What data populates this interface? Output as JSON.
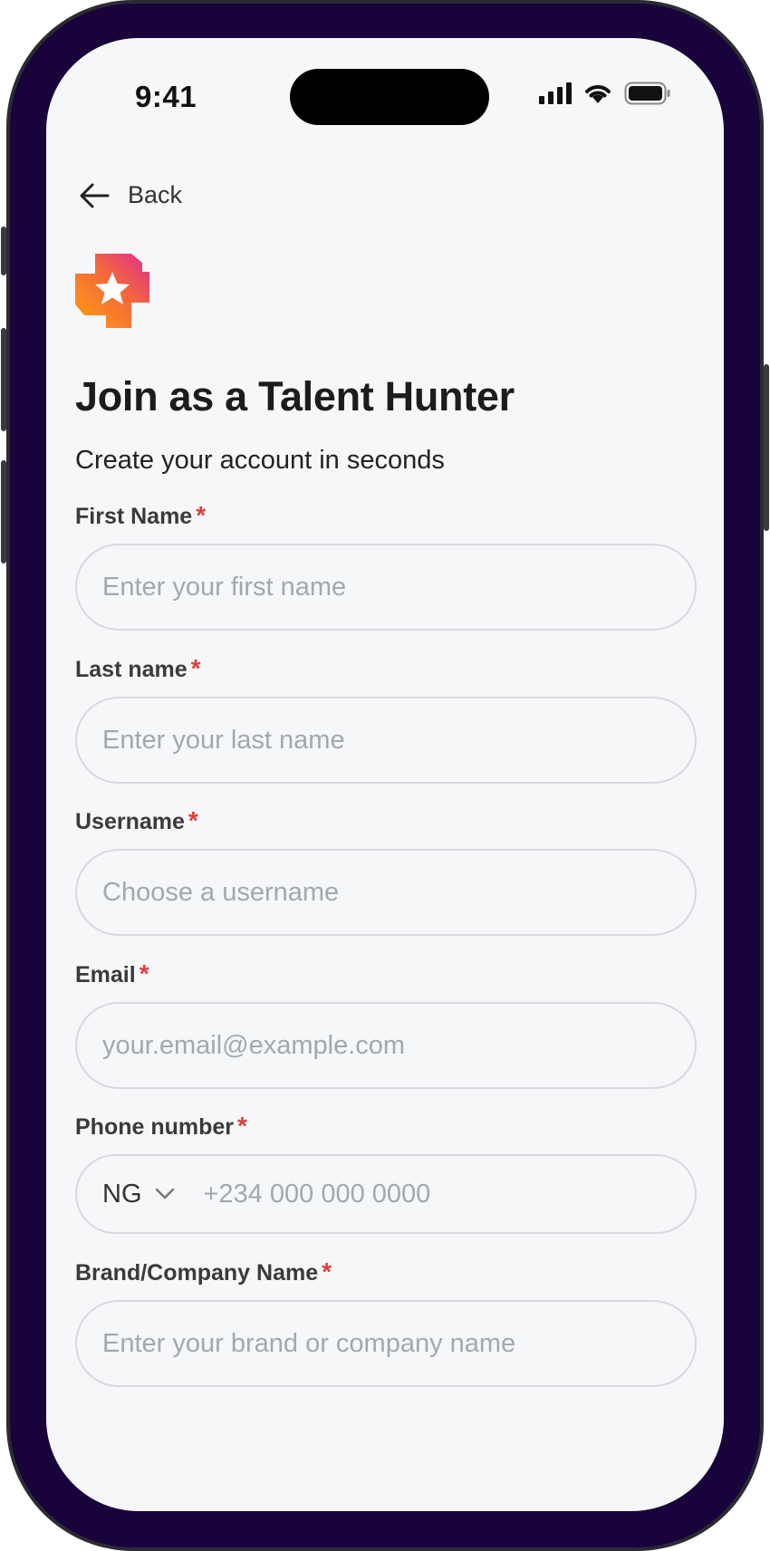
{
  "status_bar": {
    "time": "9:41",
    "icons": [
      "signal-icon",
      "wifi-icon",
      "battery-icon"
    ]
  },
  "nav": {
    "back_label": "Back",
    "back_icon": "arrow-left-icon"
  },
  "brand": {
    "logo_icon": "star-badge-icon",
    "colors": {
      "orange": "#ff9a1f",
      "pink": "#e8318a"
    }
  },
  "header": {
    "title": "Join as a Talent Hunter",
    "subtitle": "Create your account in seconds"
  },
  "form": {
    "required_marker": "*",
    "required_color": "#e03e3e",
    "first_name": {
      "label": "First Name",
      "placeholder": "Enter your first name",
      "value": ""
    },
    "last_name": {
      "label": "Last name",
      "placeholder": "Enter your last name",
      "value": ""
    },
    "username": {
      "label": "Username",
      "placeholder": "Choose a username",
      "value": ""
    },
    "email": {
      "label": "Email",
      "placeholder": "your.email@example.com",
      "value": ""
    },
    "phone": {
      "label": "Phone number",
      "country_code": "NG",
      "placeholder": "+234 000 000 0000",
      "value": ""
    },
    "company": {
      "label": "Brand/Company Name",
      "placeholder": "Enter your brand or company name",
      "value": ""
    }
  },
  "theme": {
    "device_frame": "#18033b",
    "screen_bg": "#f6f7f9",
    "input_border": "#d8d9de",
    "placeholder": "#a3a7b0"
  }
}
